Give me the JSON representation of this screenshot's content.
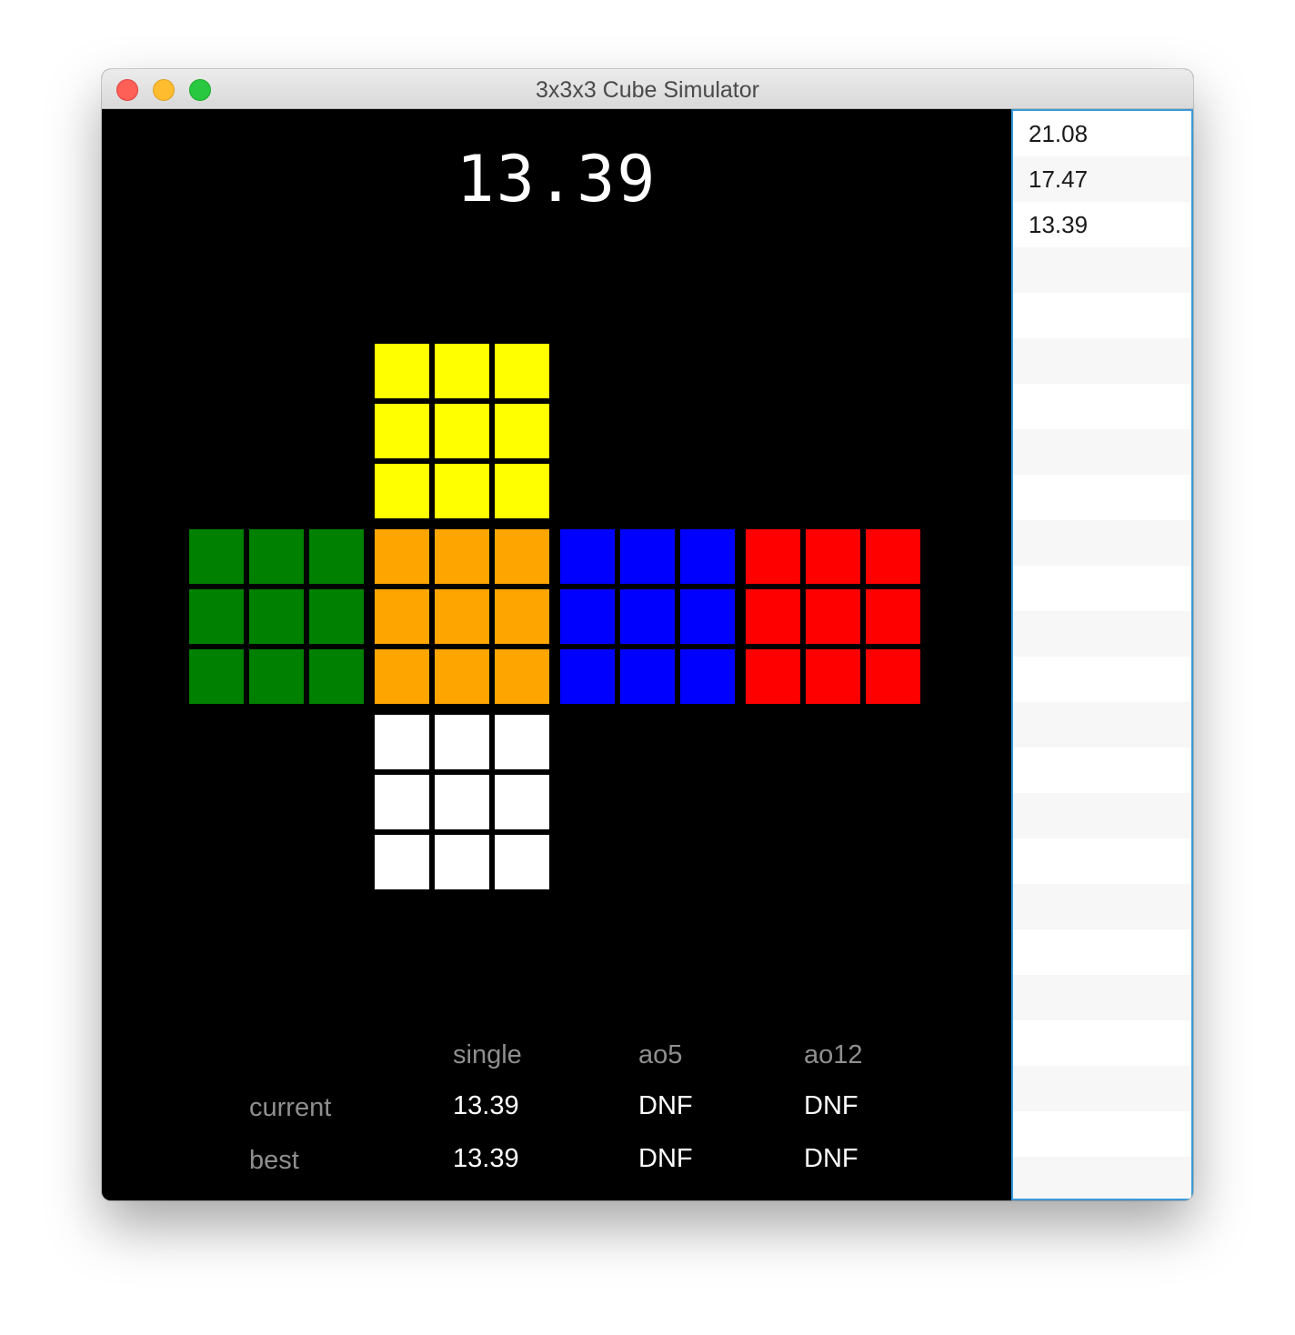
{
  "window": {
    "title": "3x3x3 Cube Simulator"
  },
  "timer": "13.39",
  "colors": {
    "yellow": "#ffff00",
    "green": "#008000",
    "orange": "#ffa500",
    "blue": "#0000ff",
    "red": "#ff0000",
    "white": "#ffffff",
    "background": "#000000"
  },
  "cube": {
    "faces": [
      {
        "name": "top",
        "color": "#ffff00"
      },
      {
        "name": "left",
        "color": "#008000"
      },
      {
        "name": "front",
        "color": "#ffa500"
      },
      {
        "name": "right",
        "color": "#0000ff"
      },
      {
        "name": "back",
        "color": "#ff0000"
      },
      {
        "name": "bottom",
        "color": "#ffffff"
      }
    ]
  },
  "stats": {
    "headers": {
      "single": "single",
      "ao5": "ao5",
      "ao12": "ao12"
    },
    "current": {
      "label": "current",
      "single": "13.39",
      "ao5": "DNF",
      "ao12": "DNF"
    },
    "best": {
      "label": "best",
      "single": "13.39",
      "ao5": "DNF",
      "ao12": "DNF"
    }
  },
  "times": [
    "21.08",
    "17.47",
    "13.39"
  ]
}
